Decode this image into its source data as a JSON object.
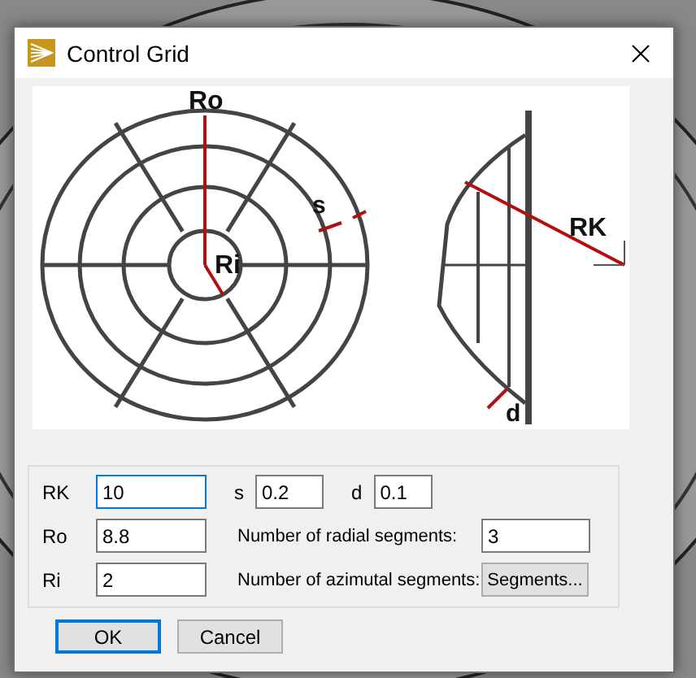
{
  "window": {
    "title": "Control Grid"
  },
  "diagram": {
    "labels": [
      "Ro",
      "Ri",
      "s",
      "RK",
      "d"
    ]
  },
  "rows": [
    {
      "label": "RK",
      "value": "10",
      "focused": true,
      "extra": [
        {
          "kind": "short",
          "label": "s",
          "value": "0.2"
        },
        {
          "kind": "short",
          "label": "d",
          "value": "0.1"
        }
      ]
    },
    {
      "label": "Ro",
      "value": "8.8",
      "focused": false,
      "extra": [
        {
          "kind": "long",
          "label": "Number of radial segments:",
          "value": "3"
        }
      ]
    },
    {
      "label": "Ri",
      "value": "2",
      "focused": false,
      "extra": [
        {
          "kind": "button",
          "label": "Number of azimutal segments:",
          "value": "Segments..."
        }
      ]
    }
  ],
  "buttons": [
    {
      "label": "OK",
      "default": true
    },
    {
      "label": "Cancel",
      "default": false
    }
  ]
}
